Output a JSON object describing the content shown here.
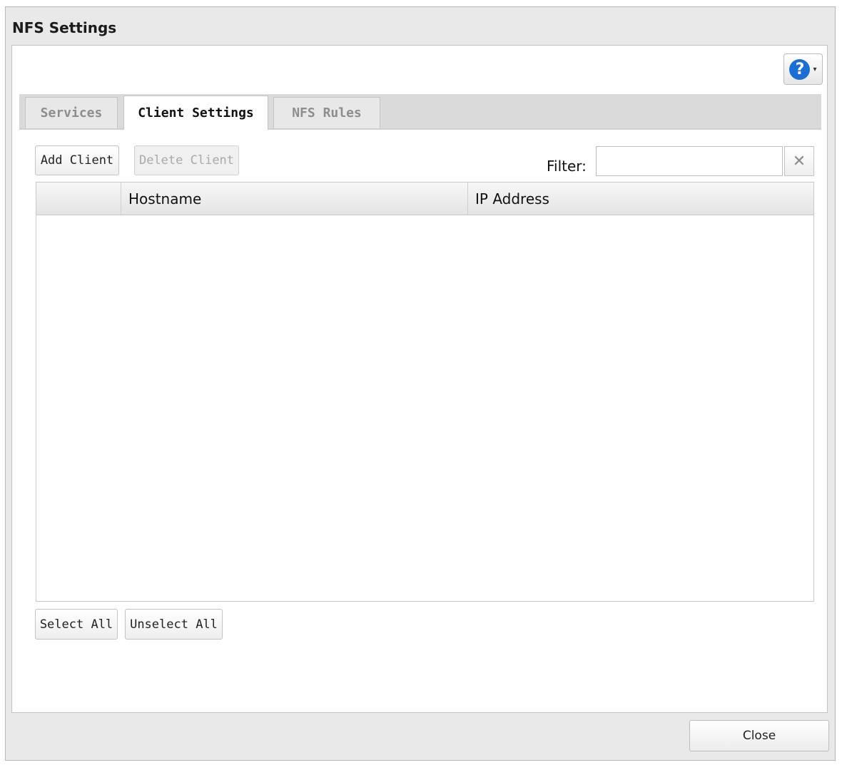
{
  "dialog": {
    "title": "NFS Settings"
  },
  "help": {
    "icon": "help-icon",
    "glyph": "?",
    "caret": "▾"
  },
  "tabs": [
    {
      "label": "Services",
      "active": false
    },
    {
      "label": "Client Settings",
      "active": true
    },
    {
      "label": "NFS Rules",
      "active": false
    }
  ],
  "toolbar": {
    "add_client_label": "Add Client",
    "delete_client_label": "Delete Client",
    "delete_client_enabled": false,
    "filter_label": "Filter:",
    "filter_value": "",
    "clear_icon": "close-icon",
    "clear_glyph": "✕"
  },
  "table": {
    "columns": [
      "",
      "Hostname",
      "IP Address"
    ],
    "rows": []
  },
  "selection": {
    "select_all_label": "Select All",
    "unselect_all_label": "Unselect All"
  },
  "footer": {
    "close_label": "Close"
  }
}
